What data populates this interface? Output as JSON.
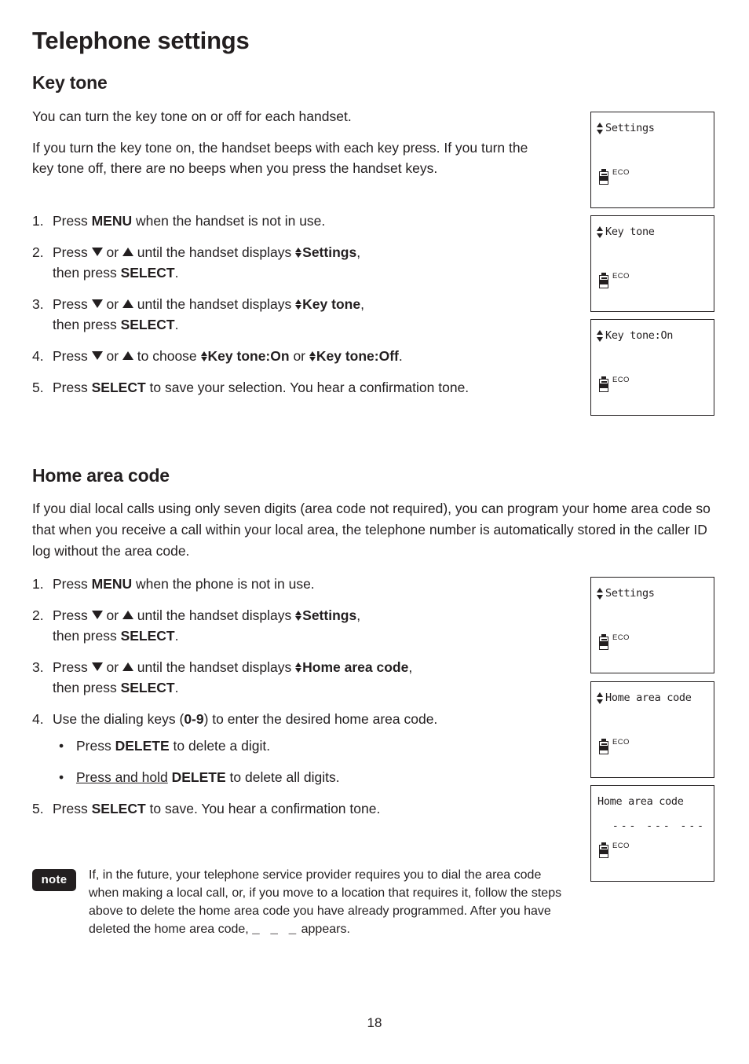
{
  "page": {
    "title": "Telephone settings",
    "number": "18"
  },
  "sections": [
    {
      "heading": "Key tone",
      "paragraphs": [
        "You can turn the key tone on or off for each handset.",
        "If you turn the key tone on, the handset beeps with each key press. If you turn the key tone off, there are no beeps when you press the handset keys."
      ],
      "steps": [
        {
          "num": "1.",
          "line1_a": "Press ",
          "line1_b": "MENU",
          "line1_c": " when the handset is not in use."
        },
        {
          "num": "2.",
          "pre": "Press ",
          "mid": " or ",
          "post": " until the handset displays ",
          "target": "Settings",
          "comma": ",",
          "line2_a": "then press ",
          "line2_b": "SELECT",
          "line2_c": "."
        },
        {
          "num": "3.",
          "pre": "Press ",
          "mid": " or ",
          "post": " until the handset displays ",
          "target": "Key tone",
          "comma": ",",
          "line2_a": "then press ",
          "line2_b": "SELECT",
          "line2_c": "."
        },
        {
          "num": "4.",
          "pre": "Press ",
          "mid": " or ",
          "post": " to choose ",
          "target": "Key tone:On",
          "joiner": " or ",
          "target2": "Key tone:Off",
          "tail": "."
        },
        {
          "num": "5.",
          "line1_a": "Press ",
          "line1_b": "SELECT",
          "line1_c": " to save your selection. You hear a confirmation tone."
        }
      ]
    },
    {
      "heading": "Home area code",
      "paragraphs": [
        "If you dial local calls using only seven digits (area code not required), you can program your home area code so that when you receive a call within your local area, the telephone number is automatically stored in the caller ID log without the area code."
      ],
      "steps": [
        {
          "num": "1.",
          "line1_a": "Press ",
          "line1_b": "MENU",
          "line1_c": " when the phone is not in use."
        },
        {
          "num": "2.",
          "pre": "Press ",
          "mid": " or ",
          "post": " until the handset displays ",
          "target": "Settings",
          "comma": ",",
          "line2_a": "then press ",
          "line2_b": "SELECT",
          "line2_c": "."
        },
        {
          "num": "3.",
          "pre": "Press ",
          "mid": " or ",
          "post": " until the handset displays ",
          "target": "Home area code",
          "comma": ",",
          "line2_a": "then press ",
          "line2_b": "SELECT",
          "line2_c": "."
        },
        {
          "num": "4.",
          "line1_a": "Use the dialing keys (",
          "line1_b": "0-9",
          "line1_c": ") to enter the desired home area code.",
          "bullets": [
            {
              "a": "Press ",
              "b": "DELETE",
              "c": " to delete a digit."
            },
            {
              "underlined": "Press and hold",
              "b": " DELETE",
              "c": " to delete all digits."
            }
          ]
        },
        {
          "num": "5.",
          "line1_a": "Press ",
          "line1_b": "SELECT",
          "line1_c": " to save. You hear a confirmation tone."
        }
      ]
    }
  ],
  "note": {
    "badge": "note",
    "text_part1": "If, in the future, your telephone service provider requires you to dial the area code when making a local call, or, if you move to a location that requires it, follow the steps above to delete the home area code you have already programmed. After you have deleted the home area code, ",
    "blanks": "_ _ _",
    "text_part2": " appears."
  },
  "lcd_screens": [
    {
      "id": "kt-settings",
      "title": "Settings",
      "arrow": true,
      "value": "",
      "eco": "ECO"
    },
    {
      "id": "kt-keytone",
      "title": "Key tone",
      "arrow": true,
      "value": "",
      "eco": "ECO"
    },
    {
      "id": "kt-keytone-on",
      "title": "Key tone:On",
      "arrow": true,
      "value": "",
      "eco": "ECO"
    },
    {
      "id": "hac-settings",
      "title": "Settings",
      "arrow": true,
      "value": "",
      "eco": "ECO"
    },
    {
      "id": "hac-homearea",
      "title": "Home area code",
      "arrow": true,
      "value": "",
      "eco": "ECO"
    },
    {
      "id": "hac-homearea-val",
      "title": "Home area code",
      "arrow": false,
      "value": "--- --- ---",
      "eco": "ECO"
    }
  ],
  "glyphs": {
    "updown_arrow": "updown-arrow-icon",
    "down_triangle": "triangle-down-icon",
    "up_triangle": "triangle-up-icon",
    "battery": "battery-icon"
  },
  "colors": {
    "text": "#231f20",
    "background": "#ffffff",
    "note_badge_bg": "#231f20"
  }
}
